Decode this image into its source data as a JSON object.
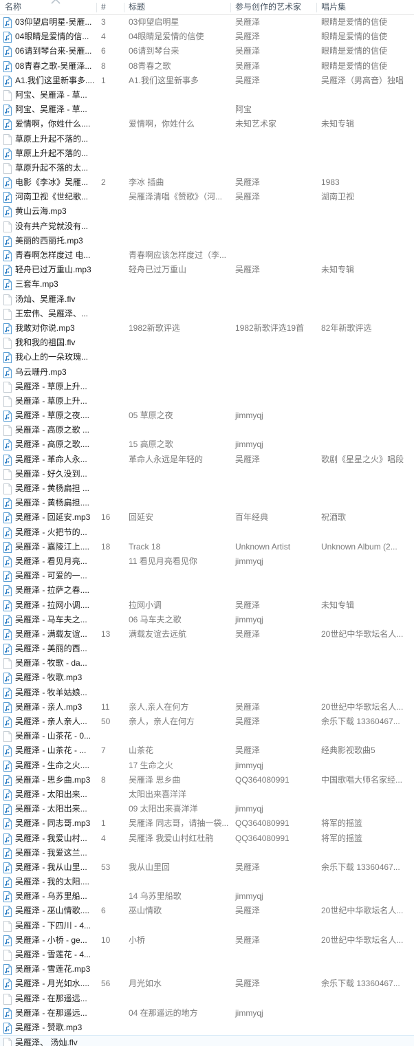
{
  "window": {
    "type": "file-explorer-detail-list",
    "selection_highlight_color": "#f7fbfe",
    "selection_border_color": "#d8eaf7",
    "header_text_color": "#4a5764",
    "name_text_color": "#1b1b1b",
    "meta_text_color": "#7b7b7b"
  },
  "columns": [
    {
      "key": "name",
      "label": "名称",
      "sorted": true,
      "sort_dir": "asc"
    },
    {
      "key": "num",
      "label": "#",
      "sorted": false
    },
    {
      "key": "title",
      "label": "标题",
      "sorted": false
    },
    {
      "key": "artist",
      "label": "参与创作的艺术家",
      "sorted": false
    },
    {
      "key": "album",
      "label": "唱片集",
      "sorted": false
    }
  ],
  "rows": [
    {
      "icon": "music-file-icon",
      "name": "03仰望启明星-吴雁...",
      "num": "3",
      "title": "03仰望启明星",
      "artist": "吴雁泽",
      "album": "眼睛是爱情的信使",
      "highlighted": false
    },
    {
      "icon": "music-file-icon",
      "name": "04眼睛是爱情的信...",
      "num": "4",
      "title": "04眼睛是爱情的信使",
      "artist": "吴雁泽",
      "album": "眼睛是爱情的信使",
      "highlighted": false
    },
    {
      "icon": "music-file-icon",
      "name": "06请到琴台来-吴雁...",
      "num": "6",
      "title": "06请到琴台来",
      "artist": "吴雁泽",
      "album": "眼睛是爱情的信使",
      "highlighted": false
    },
    {
      "icon": "music-file-icon",
      "name": "08青春之歌-吴雁泽...",
      "num": "8",
      "title": "08青春之歌",
      "artist": "吴雁泽",
      "album": "眼睛是爱情的信使",
      "highlighted": false
    },
    {
      "icon": "music-file-icon",
      "name": "A1.我们这里新事多....",
      "num": "1",
      "title": "A1.我们这里新事多",
      "artist": "吴雁泽",
      "album": "吴雁泽（男高音）独唱",
      "highlighted": false
    },
    {
      "icon": "generic-file-icon",
      "name": "阿宝、吴雁泽 - 草...",
      "num": "",
      "title": "",
      "artist": "",
      "album": "",
      "highlighted": false
    },
    {
      "icon": "music-file-icon",
      "name": "阿宝、吴雁泽 - 草...",
      "num": "",
      "title": "",
      "artist": "阿宝",
      "album": "",
      "highlighted": false
    },
    {
      "icon": "music-file-icon",
      "name": "爱情啊，你姓什么....",
      "num": "",
      "title": "爱情啊，你姓什么",
      "artist": "未知艺术家",
      "album": "未知专辑",
      "highlighted": false
    },
    {
      "icon": "generic-file-icon",
      "name": "草原上升起不落的...",
      "num": "",
      "title": "",
      "artist": "",
      "album": "",
      "highlighted": false
    },
    {
      "icon": "music-file-icon",
      "name": "草原上升起不落的...",
      "num": "",
      "title": "",
      "artist": "",
      "album": "",
      "highlighted": false
    },
    {
      "icon": "generic-file-icon",
      "name": "草原升起不落的太...",
      "num": "",
      "title": "",
      "artist": "",
      "album": "",
      "highlighted": false
    },
    {
      "icon": "music-file-icon",
      "name": "电影《李冰》吴雁...",
      "num": "2",
      "title": "李冰 插曲",
      "artist": "吴雁泽",
      "album": "1983",
      "highlighted": false
    },
    {
      "icon": "music-file-icon",
      "name": "河南卫视《世纪歌...",
      "num": "",
      "title": "吴雁泽清唱《赞歌》（河...",
      "artist": "吴雁泽",
      "album": "湖南卫视",
      "highlighted": false
    },
    {
      "icon": "music-file-icon",
      "name": "黄山云海.mp3",
      "num": "",
      "title": "",
      "artist": "",
      "album": "",
      "highlighted": false
    },
    {
      "icon": "generic-file-icon",
      "name": "没有共产党就没有...",
      "num": "",
      "title": "",
      "artist": "",
      "album": "",
      "highlighted": false
    },
    {
      "icon": "music-file-icon",
      "name": "美丽的西丽托.mp3",
      "num": "",
      "title": "",
      "artist": "",
      "album": "",
      "highlighted": false
    },
    {
      "icon": "music-file-icon",
      "name": "青春啊怎样度过 电...",
      "num": "",
      "title": "青春啊应该怎样度过（李...",
      "artist": "",
      "album": "",
      "highlighted": false
    },
    {
      "icon": "music-file-icon",
      "name": "轻舟已过万重山.mp3",
      "num": "",
      "title": "轻舟已过万重山",
      "artist": "吴雁泽",
      "album": "未知专辑",
      "highlighted": false
    },
    {
      "icon": "music-file-icon",
      "name": "三套车.mp3",
      "num": "",
      "title": "",
      "artist": "",
      "album": "",
      "highlighted": false
    },
    {
      "icon": "generic-file-icon",
      "name": "汤灿、吴雁泽.flv",
      "num": "",
      "title": "",
      "artist": "",
      "album": "",
      "highlighted": false
    },
    {
      "icon": "generic-file-icon",
      "name": "王宏伟、吴雁泽、...",
      "num": "",
      "title": "",
      "artist": "",
      "album": "",
      "highlighted": false
    },
    {
      "icon": "music-file-icon",
      "name": "我敢对你说.mp3",
      "num": "",
      "title": "1982新歌评选",
      "artist": "1982新歌评选19首",
      "album": "82年新歌评选",
      "highlighted": false
    },
    {
      "icon": "generic-file-icon",
      "name": "我和我的祖国.flv",
      "num": "",
      "title": "",
      "artist": "",
      "album": "",
      "highlighted": false
    },
    {
      "icon": "music-file-icon",
      "name": "我心上的一朵玫瑰...",
      "num": "",
      "title": "",
      "artist": "",
      "album": "",
      "highlighted": false
    },
    {
      "icon": "music-file-icon",
      "name": "乌云珊丹.mp3",
      "num": "",
      "title": "",
      "artist": "",
      "album": "",
      "highlighted": false
    },
    {
      "icon": "generic-file-icon",
      "name": "吴雁泽 - 草原上升...",
      "num": "",
      "title": "",
      "artist": "",
      "album": "",
      "highlighted": false
    },
    {
      "icon": "generic-file-icon",
      "name": "吴雁泽 - 草原上升...",
      "num": "",
      "title": "",
      "artist": "",
      "album": "",
      "highlighted": false
    },
    {
      "icon": "music-file-icon",
      "name": "吴雁泽 - 草原之夜....",
      "num": "",
      "title": "05 草原之夜",
      "artist": "jimmyqj",
      "album": "",
      "highlighted": false
    },
    {
      "icon": "generic-file-icon",
      "name": "吴雁泽 - 高原之歌 ...",
      "num": "",
      "title": "",
      "artist": "",
      "album": "",
      "highlighted": false
    },
    {
      "icon": "music-file-icon",
      "name": "吴雁泽 - 高原之歌....",
      "num": "",
      "title": "15 高原之歌",
      "artist": "jimmyqj",
      "album": "",
      "highlighted": false
    },
    {
      "icon": "music-file-icon",
      "name": "吴雁泽 - 革命人永...",
      "num": "",
      "title": "革命人永远是年轻的",
      "artist": "吴雁泽",
      "album": "歌剧《星星之火》唱段",
      "highlighted": false
    },
    {
      "icon": "generic-file-icon",
      "name": "吴雁泽 - 好久没到...",
      "num": "",
      "title": "",
      "artist": "",
      "album": "",
      "highlighted": false
    },
    {
      "icon": "generic-file-icon",
      "name": "吴雁泽 - 黄杨扁担 ...",
      "num": "",
      "title": "",
      "artist": "",
      "album": "",
      "highlighted": false
    },
    {
      "icon": "music-file-icon",
      "name": "吴雁泽 - 黄杨扁担....",
      "num": "",
      "title": "",
      "artist": "",
      "album": "",
      "highlighted": false
    },
    {
      "icon": "music-file-icon",
      "name": "吴雁泽 - 回延安.mp3",
      "num": "16",
      "title": "回延安",
      "artist": "百年经典",
      "album": "祝酒歌",
      "highlighted": false
    },
    {
      "icon": "music-file-icon",
      "name": "吴雁泽 - 火把节的...",
      "num": "",
      "title": "",
      "artist": "",
      "album": "",
      "highlighted": false
    },
    {
      "icon": "music-file-icon",
      "name": "吴雁泽 - 嘉陵江上....",
      "num": "18",
      "title": "Track 18",
      "artist": "Unknown Artist",
      "album": "Unknown Album (2...",
      "highlighted": false
    },
    {
      "icon": "music-file-icon",
      "name": "吴雁泽 - 看见月亮...",
      "num": "",
      "title": "11 看见月亮看见你",
      "artist": "jimmyqj",
      "album": "",
      "highlighted": false
    },
    {
      "icon": "music-file-icon",
      "name": "吴雁泽 - 可爱的一...",
      "num": "",
      "title": "",
      "artist": "",
      "album": "",
      "highlighted": false
    },
    {
      "icon": "music-file-icon",
      "name": "吴雁泽 - 拉萨之春....",
      "num": "",
      "title": "",
      "artist": "",
      "album": "",
      "highlighted": false
    },
    {
      "icon": "music-file-icon",
      "name": "吴雁泽 - 拉网小调....",
      "num": "",
      "title": "拉网小调",
      "artist": "吴雁泽",
      "album": "未知专辑",
      "highlighted": false
    },
    {
      "icon": "music-file-icon",
      "name": "吴雁泽 - 马车夫之...",
      "num": "",
      "title": "06 马车夫之歌",
      "artist": "jimmyqj",
      "album": "",
      "highlighted": false
    },
    {
      "icon": "music-file-icon",
      "name": "吴雁泽 - 满载友谊...",
      "num": "13",
      "title": "满载友谊去远航",
      "artist": "吴雁泽",
      "album": "20世纪中华歌坛名人...",
      "highlighted": false
    },
    {
      "icon": "music-file-icon",
      "name": "吴雁泽 - 美丽的西...",
      "num": "",
      "title": "",
      "artist": "",
      "album": "",
      "highlighted": false
    },
    {
      "icon": "generic-file-icon",
      "name": "吴雁泽 - 牧歌 - da...",
      "num": "",
      "title": "",
      "artist": "",
      "album": "",
      "highlighted": false
    },
    {
      "icon": "music-file-icon",
      "name": "吴雁泽 - 牧歌.mp3",
      "num": "",
      "title": "",
      "artist": "",
      "album": "",
      "highlighted": false
    },
    {
      "icon": "music-file-icon",
      "name": "吴雁泽 - 牧羊姑娘...",
      "num": "",
      "title": "",
      "artist": "",
      "album": "",
      "highlighted": false
    },
    {
      "icon": "music-file-icon",
      "name": "吴雁泽 - 亲人.mp3",
      "num": "11",
      "title": "亲人,亲人在何方",
      "artist": "吴雁泽",
      "album": "20世纪中华歌坛名人...",
      "highlighted": false
    },
    {
      "icon": "music-file-icon",
      "name": "吴雁泽 - 亲人亲人...",
      "num": "50",
      "title": "亲人，亲人在何方",
      "artist": "吴雁泽",
      "album": "余乐下载 13360467...",
      "highlighted": false
    },
    {
      "icon": "generic-file-icon",
      "name": "吴雁泽 - 山茶花 - 0...",
      "num": "",
      "title": "",
      "artist": "",
      "album": "",
      "highlighted": false
    },
    {
      "icon": "music-file-icon",
      "name": "吴雁泽 - 山茶花 - ...",
      "num": "7",
      "title": "山茶花",
      "artist": "吴雁泽",
      "album": "经典影视歌曲5",
      "highlighted": false
    },
    {
      "icon": "music-file-icon",
      "name": "吴雁泽 - 生命之火....",
      "num": "",
      "title": "17 生命之火",
      "artist": "jimmyqj",
      "album": "",
      "highlighted": false
    },
    {
      "icon": "music-file-icon",
      "name": "吴雁泽 - 思乡曲.mp3",
      "num": "8",
      "title": "吴雁泽 思乡曲",
      "artist": "QQ364080991",
      "album": "中国歌唱大师名家经...",
      "highlighted": false
    },
    {
      "icon": "music-file-icon",
      "name": "吴雁泽 - 太阳出来...",
      "num": "",
      "title": "太阳出来喜洋洋",
      "artist": "",
      "album": "",
      "highlighted": false
    },
    {
      "icon": "music-file-icon",
      "name": "吴雁泽 - 太阳出来...",
      "num": "",
      "title": "09 太阳出来喜洋洋",
      "artist": "jimmyqj",
      "album": "",
      "highlighted": false
    },
    {
      "icon": "music-file-icon",
      "name": "吴雁泽 - 同志哥.mp3",
      "num": "1",
      "title": "吴雁泽 同志哥，请抽一袋...",
      "artist": "QQ364080991",
      "album": "将军的摇篮",
      "highlighted": false
    },
    {
      "icon": "music-file-icon",
      "name": "吴雁泽 - 我爱山村...",
      "num": "4",
      "title": "吴雁泽 我爱山村红杜鹃",
      "artist": "QQ364080991",
      "album": "将军的摇篮",
      "highlighted": false
    },
    {
      "icon": "music-file-icon",
      "name": "吴雁泽 - 我爱这兰...",
      "num": "",
      "title": "",
      "artist": "",
      "album": "",
      "highlighted": false
    },
    {
      "icon": "music-file-icon",
      "name": "吴雁泽 - 我从山里...",
      "num": "53",
      "title": "我从山里回",
      "artist": "吴雁泽",
      "album": "余乐下载 13360467...",
      "highlighted": false
    },
    {
      "icon": "music-file-icon",
      "name": "吴雁泽 - 我的太阳....",
      "num": "",
      "title": "",
      "artist": "",
      "album": "",
      "highlighted": false
    },
    {
      "icon": "music-file-icon",
      "name": "吴雁泽 - 乌苏里船...",
      "num": "",
      "title": "14 乌苏里船歌",
      "artist": "jimmyqj",
      "album": "",
      "highlighted": false
    },
    {
      "icon": "music-file-icon",
      "name": "吴雁泽 - 巫山情歌....",
      "num": "6",
      "title": "巫山情歌",
      "artist": "吴雁泽",
      "album": "20世纪中华歌坛名人...",
      "highlighted": false
    },
    {
      "icon": "generic-file-icon",
      "name": "吴雁泽 - 下四川 - 4...",
      "num": "",
      "title": "",
      "artist": "",
      "album": "",
      "highlighted": false
    },
    {
      "icon": "music-file-icon",
      "name": "吴雁泽 - 小桥 - ge...",
      "num": "10",
      "title": "小桥",
      "artist": "吴雁泽",
      "album": "20世纪中华歌坛名人...",
      "highlighted": false
    },
    {
      "icon": "generic-file-icon",
      "name": "吴雁泽 - 雪莲花 - 4...",
      "num": "",
      "title": "",
      "artist": "",
      "album": "",
      "highlighted": false
    },
    {
      "icon": "music-file-icon",
      "name": "吴雁泽 - 雪莲花.mp3",
      "num": "",
      "title": "",
      "artist": "",
      "album": "",
      "highlighted": false
    },
    {
      "icon": "music-file-icon",
      "name": "吴雁泽 - 月光如水....",
      "num": "56",
      "title": "月光如水",
      "artist": "吴雁泽",
      "album": "余乐下载 13360467...",
      "highlighted": false
    },
    {
      "icon": "generic-file-icon",
      "name": "吴雁泽 - 在那遥远...",
      "num": "",
      "title": "",
      "artist": "",
      "album": "",
      "highlighted": false
    },
    {
      "icon": "music-file-icon",
      "name": "吴雁泽 - 在那遥远...",
      "num": "",
      "title": "04 在那遥远的地方",
      "artist": "jimmyqj",
      "album": "",
      "highlighted": false
    },
    {
      "icon": "music-file-icon",
      "name": "吴雁泽 - 赞歌.mp3",
      "num": "",
      "title": "",
      "artist": "",
      "album": "",
      "highlighted": false
    },
    {
      "icon": "generic-file-icon",
      "name": "吴雁泽、 汤灿.flv",
      "num": "",
      "title": "",
      "artist": "",
      "album": "",
      "highlighted": true
    }
  ]
}
